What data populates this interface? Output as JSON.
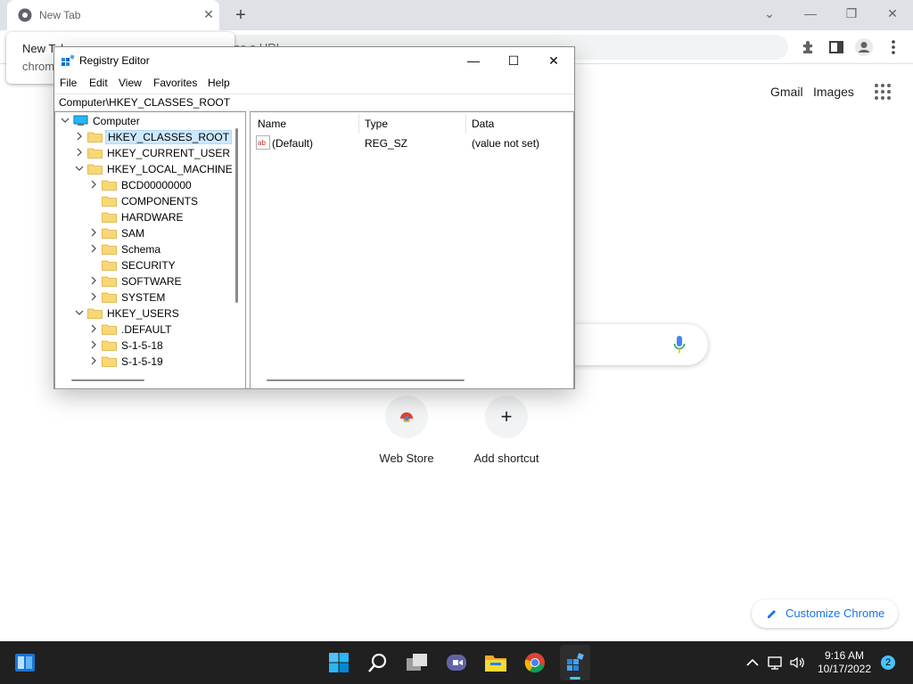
{
  "chrome": {
    "tab_title": "New Tab",
    "tab_close": "✕",
    "new_tab": "+",
    "omnibox_text": "ne a URL",
    "hover_card": {
      "title": "New Tab",
      "subtitle": "chrome"
    },
    "win_controls": {
      "dropdown": "⌄",
      "minimize": "—",
      "restore": "❐",
      "close": "✕"
    }
  },
  "ntp": {
    "gmail": "Gmail",
    "images": "Images",
    "shortcuts": [
      {
        "label": "Web Store"
      },
      {
        "label": "Add shortcut",
        "glyph": "+"
      }
    ],
    "customize_label": "Customize Chrome"
  },
  "regedit": {
    "title": "Registry Editor",
    "controls": {
      "minimize": "—",
      "maximize": "☐",
      "close": "✕"
    },
    "menu": [
      "File",
      "Edit",
      "View",
      "Favorites",
      "Help"
    ],
    "address": "Computer\\HKEY_CLASSES_ROOT",
    "tree": [
      {
        "label": "Computer",
        "depth": 0,
        "expander": "open",
        "icon": "computer-icon"
      },
      {
        "label": "HKEY_CLASSES_ROOT",
        "depth": 1,
        "expander": "closed",
        "icon": "folder-icon",
        "selected": true
      },
      {
        "label": "HKEY_CURRENT_USER",
        "depth": 1,
        "expander": "closed",
        "icon": "folder-icon"
      },
      {
        "label": "HKEY_LOCAL_MACHINE",
        "depth": 1,
        "expander": "open",
        "icon": "folder-icon"
      },
      {
        "label": "BCD00000000",
        "depth": 2,
        "expander": "closed",
        "icon": "folder-icon"
      },
      {
        "label": "COMPONENTS",
        "depth": 2,
        "expander": "none",
        "icon": "folder-icon"
      },
      {
        "label": "HARDWARE",
        "depth": 2,
        "expander": "none",
        "icon": "folder-icon"
      },
      {
        "label": "SAM",
        "depth": 2,
        "expander": "closed",
        "icon": "folder-icon"
      },
      {
        "label": "Schema",
        "depth": 2,
        "expander": "closed",
        "icon": "folder-icon"
      },
      {
        "label": "SECURITY",
        "depth": 2,
        "expander": "none",
        "icon": "folder-icon"
      },
      {
        "label": "SOFTWARE",
        "depth": 2,
        "expander": "closed",
        "icon": "folder-icon"
      },
      {
        "label": "SYSTEM",
        "depth": 2,
        "expander": "closed",
        "icon": "folder-icon"
      },
      {
        "label": "HKEY_USERS",
        "depth": 1,
        "expander": "open",
        "icon": "folder-icon"
      },
      {
        "label": ".DEFAULT",
        "depth": 2,
        "expander": "closed",
        "icon": "folder-icon"
      },
      {
        "label": "S-1-5-18",
        "depth": 2,
        "expander": "closed",
        "icon": "folder-icon"
      },
      {
        "label": "S-1-5-19",
        "depth": 2,
        "expander": "closed",
        "icon": "folder-icon"
      }
    ],
    "list": {
      "columns": [
        "Name",
        "Type",
        "Data"
      ],
      "rows": [
        {
          "name": "(Default)",
          "type": "REG_SZ",
          "data": "(value not set)"
        }
      ]
    }
  },
  "taskbar": {
    "time": "9:16 AM",
    "date": "10/17/2022",
    "notifications": "2",
    "apps": [
      "widgets-icon",
      "start-icon",
      "search-icon",
      "task-view-icon",
      "teams-chat-icon",
      "file-explorer-icon",
      "chrome-icon",
      "regedit-icon"
    ]
  },
  "colors": {
    "selection": "#cce8ff",
    "taskbar": "#202020",
    "accent": "#1a73e8"
  }
}
